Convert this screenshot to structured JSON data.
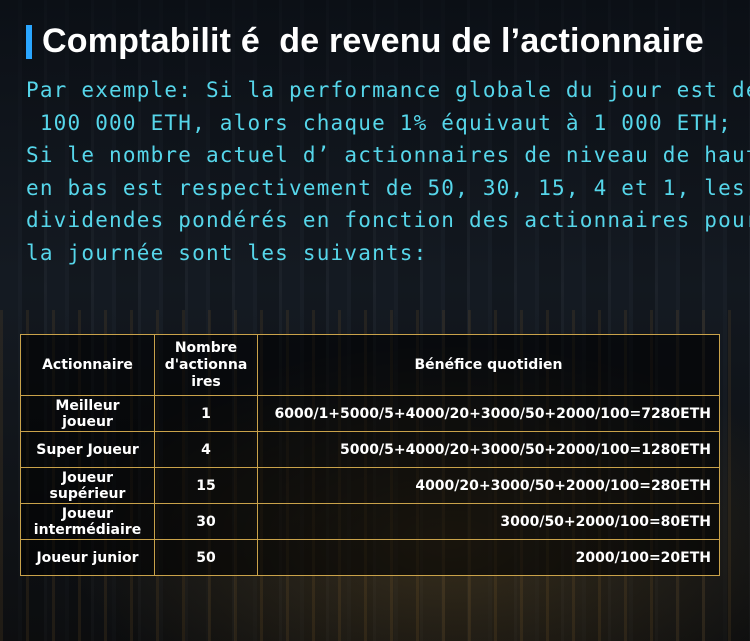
{
  "title": "Comptabilit é  de revenu de l’actionnaire",
  "intro": [
    "Par exemple: Si la performance globale du jour est de",
    " 100 000 ETH, alors chaque 1% équivaut à 1 000 ETH;",
    "Si le nombre actuel d’ actionnaires de niveau de haut",
    "en bas est respectivement de 50, 30, 15, 4 et 1, les",
    "dividendes pondérés en fonction des actionnaires pour",
    "la journée sont les suivants:"
  ],
  "table": {
    "headers": [
      "Actionnaire",
      "Nombre d'actionnaires",
      "Bénéfice quotidien"
    ],
    "rows": [
      {
        "name": "Meilleur joueur",
        "count": "1",
        "profit": "6000/1+5000/5+4000/20+3000/50+2000/100=7280ETH"
      },
      {
        "name": "Super Joueur",
        "count": "4",
        "profit": "5000/5+4000/20+3000/50+2000/100=1280ETH"
      },
      {
        "name": "Joueur supérieur",
        "count": "15",
        "profit": "4000/20+3000/50+2000/100=280ETH"
      },
      {
        "name": "Joueur intermédiaire",
        "count": "30",
        "profit": "3000/50+2000/100=80ETH"
      },
      {
        "name": "Joueur junior",
        "count": "50",
        "profit": "2000/100=20ETH"
      }
    ]
  },
  "colors": {
    "accent_bar": "#2aa6ff",
    "intro_text": "#56d6ea",
    "table_border": "#c9a24a"
  }
}
